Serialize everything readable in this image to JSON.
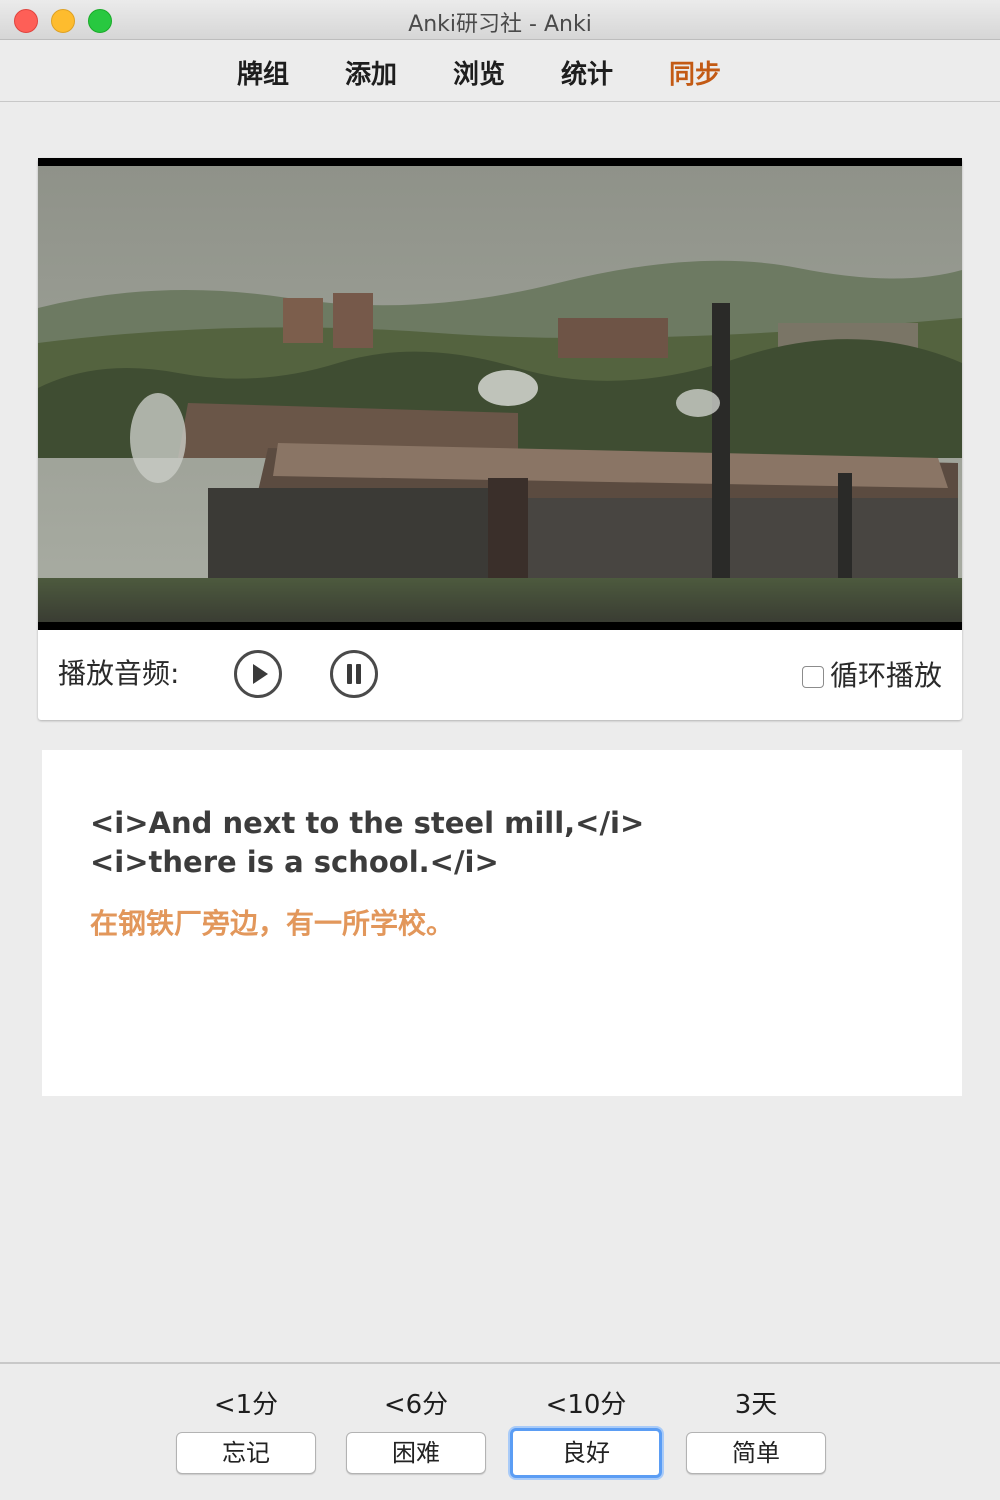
{
  "window": {
    "title": "Anki研习社 - Anki"
  },
  "toolbar": {
    "items": [
      {
        "label": "牌组"
      },
      {
        "label": "添加"
      },
      {
        "label": "浏览"
      },
      {
        "label": "统计"
      },
      {
        "label": "同步"
      }
    ],
    "sync_color": "#c35a14"
  },
  "player": {
    "audio_label": "播放音频:",
    "play_icon": "play-circle-icon",
    "pause_icon": "pause-circle-icon",
    "loop_label": "循环播放",
    "loop_checked": false
  },
  "card": {
    "english_lines": [
      "<i>And next to the steel mill,</i>",
      "<i>there is a school.</i>"
    ],
    "chinese": "在钢铁厂旁边，有一所学校。",
    "chinese_color": "#e2975b"
  },
  "answers": [
    {
      "interval": "<1分",
      "label": "忘记"
    },
    {
      "interval": "<6分",
      "label": "困难"
    },
    {
      "interval": "<10分",
      "label": "良好",
      "focused": true
    },
    {
      "interval": "3天",
      "label": "简单"
    }
  ]
}
